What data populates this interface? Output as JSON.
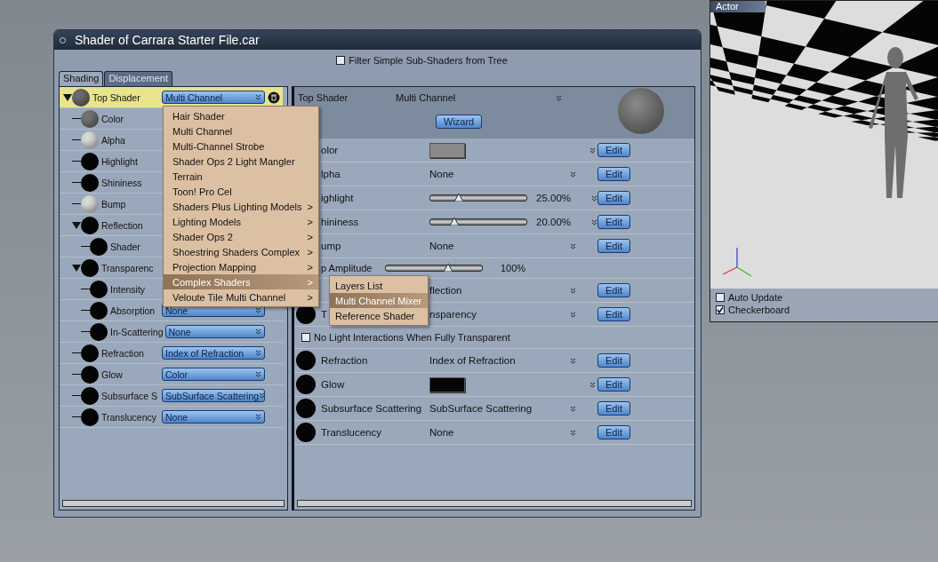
{
  "window": {
    "title": "Shader of Carrara Starter File.car"
  },
  "filter": {
    "label": "Filter Simple Sub-Shaders from Tree",
    "checked": false
  },
  "tabs": [
    {
      "label": "Shading",
      "selected": true
    },
    {
      "label": "Displacement",
      "selected": false
    }
  ],
  "tree": [
    {
      "label": "Top Shader",
      "color": "#6b6b6b",
      "selected": true,
      "expanded": true,
      "dropdown": "Multi Channel",
      "children": [
        {
          "label": "Color",
          "color": "#727272",
          "selected": false
        },
        {
          "label": "Alpha",
          "color": "#d8d8d8",
          "selected": false
        },
        {
          "label": "Highlight",
          "color": "#050505",
          "selected": false
        },
        {
          "label": "Shininess",
          "color": "#050505",
          "selected": false
        },
        {
          "label": "Bump",
          "color": "#d8d8d8",
          "selected": false
        },
        {
          "label": "Reflection",
          "color": "#050505",
          "selected": false,
          "expanded": true,
          "children": [
            {
              "label": "Shader",
              "color": "#050505",
              "selected": false
            }
          ]
        },
        {
          "label": "Transparenc",
          "color": "#050505",
          "selected": false,
          "expanded": true,
          "children": [
            {
              "label": "Intensity",
              "color": "#050505",
              "selected": false
            },
            {
              "label": "Absorption",
              "color": "#050505",
              "selected": false,
              "dropdown": "None"
            },
            {
              "label": "In-Scattering",
              "color": "#050505",
              "selected": false,
              "dropdown": "None"
            }
          ]
        },
        {
          "label": "Refraction",
          "color": "#050505",
          "selected": false,
          "dropdown": "Index of Refraction"
        },
        {
          "label": "Glow",
          "color": "#050505",
          "selected": false,
          "dropdown": "Color"
        },
        {
          "label": "Subsurface S",
          "color": "#050505",
          "selected": false,
          "dropdown": "SubSurface Scattering"
        },
        {
          "label": "Translucency",
          "color": "#050505",
          "selected": false,
          "dropdown": "None"
        }
      ]
    }
  ],
  "menu": {
    "items": [
      {
        "label": "Hair Shader",
        "selected": false
      },
      {
        "label": "Multi Channel",
        "selected": false
      },
      {
        "label": "Multi-Channel Strobe",
        "selected": false
      },
      {
        "label": "Shader Ops 2 Light Mangler",
        "selected": false
      },
      {
        "label": "Terrain",
        "selected": false
      },
      {
        "label": "Toon! Pro Cel",
        "selected": false
      },
      {
        "label": "Shaders Plus Lighting Models",
        "arrow": ">",
        "selected": false
      },
      {
        "label": "Lighting Models",
        "arrow": ">",
        "selected": false
      },
      {
        "label": "Shader Ops 2",
        "arrow": ">",
        "selected": false
      },
      {
        "label": "Shoestring Shaders Complex",
        "arrow": ">",
        "selected": false
      },
      {
        "label": "Projection Mapping",
        "arrow": ">",
        "selected": false
      },
      {
        "label": "Complex Shaders",
        "arrow": ">",
        "selected": true
      },
      {
        "label": "Veloute Tile Multi Channel",
        "arrow": ">",
        "selected": false
      }
    ],
    "submenu": [
      {
        "label": "Layers List",
        "selected": false
      },
      {
        "label": "Multi Channel Mixer",
        "selected": true
      },
      {
        "label": "Reference Shader",
        "selected": false
      }
    ]
  },
  "editor": {
    "header": {
      "label": "Top Shader",
      "value": "Multi Channel",
      "button": "Wizard"
    },
    "rows": [
      {
        "kind": "color",
        "label": "olor",
        "color": "#8a8a8a",
        "edit": "Edit"
      },
      {
        "kind": "dropdown",
        "label": "lpha",
        "value": "None",
        "edit": "Edit"
      },
      {
        "kind": "slider",
        "label": "ighlight",
        "level": 0.28,
        "reading": "25.00%",
        "edit": "Edit"
      },
      {
        "kind": "slider",
        "label": "hininess",
        "level": 0.22,
        "reading": "20.00%",
        "edit": "Edit"
      },
      {
        "kind": "dropdown",
        "label": "ump",
        "value": "None",
        "edit": "Edit"
      },
      {
        "kind": "subslider",
        "label": "p Amplitude",
        "level": 0.66,
        "reading": "100%"
      },
      {
        "kind": "dropdown",
        "value": "flection",
        "edit": "Edit"
      },
      {
        "kind": "dropdown",
        "ball": true,
        "label": "T",
        "value": "nsparency",
        "edit": "Edit"
      },
      {
        "kind": "checkbox",
        "label": "No Light Interactions When Fully Transparent",
        "checked": false
      },
      {
        "kind": "dropdown",
        "ball": true,
        "label": "Refraction",
        "value": "Index of Refraction",
        "edit": "Edit"
      },
      {
        "kind": "color",
        "ball": true,
        "label": "Glow",
        "color": "#050505",
        "edit": "Edit"
      },
      {
        "kind": "dropdown",
        "ball": true,
        "label": "Subsurface Scattering",
        "value": "SubSurface Scattering",
        "edit": "Edit"
      },
      {
        "kind": "dropdown",
        "ball": true,
        "label": "Translucency",
        "value": "None",
        "edit": "Edit"
      }
    ]
  },
  "preview": {
    "title": "Actor",
    "checkboxes": [
      {
        "label": "Auto Update",
        "checked": false
      },
      {
        "label": "Checkerboard",
        "checked": true
      }
    ]
  }
}
